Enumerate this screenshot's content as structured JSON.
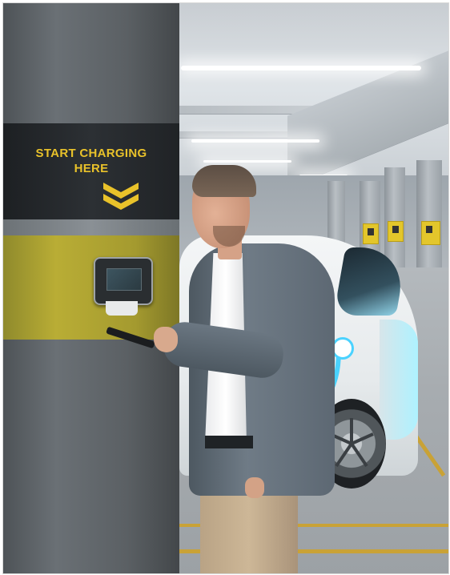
{
  "sign": {
    "line1": "START CHARGING",
    "line2": "HERE",
    "arrow_icon": "double-chevron-down-icon"
  },
  "colors": {
    "sign_yellow": "#e9c22a",
    "pillar_band_yellow": "#b9ad35",
    "cable_blue": "#4ad2ff",
    "car_white": "#f4f6f7"
  }
}
